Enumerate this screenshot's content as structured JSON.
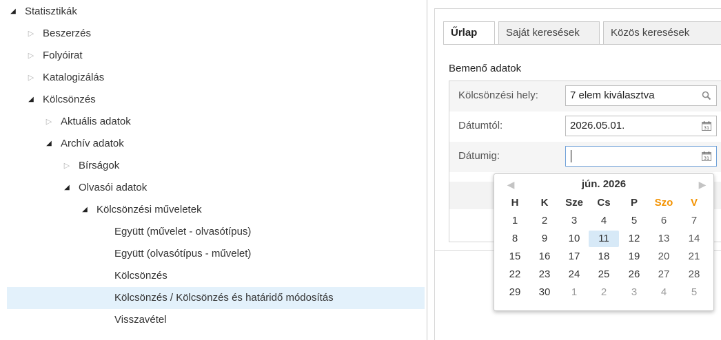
{
  "tree": {
    "items": [
      {
        "label": "Statisztikák",
        "state": "expanded"
      },
      {
        "label": "Beszerzés",
        "state": "collapsed"
      },
      {
        "label": "Folyóirat",
        "state": "collapsed"
      },
      {
        "label": "Katalogizálás",
        "state": "collapsed"
      },
      {
        "label": "Kölcsönzés",
        "state": "expanded"
      },
      {
        "label": "Aktuális adatok",
        "state": "collapsed"
      },
      {
        "label": "Archív adatok",
        "state": "expanded"
      },
      {
        "label": "Bírságok",
        "state": "collapsed"
      },
      {
        "label": "Olvasói adatok",
        "state": "expanded"
      },
      {
        "label": "Kölcsönzési műveletek",
        "state": "expanded"
      },
      {
        "label": "Együtt (művelet - olvasótípus)",
        "state": "leaf"
      },
      {
        "label": "Együtt (olvasótípus - művelet)",
        "state": "leaf"
      },
      {
        "label": "Kölcsönzés",
        "state": "leaf"
      },
      {
        "label": "Kölcsönzés / Kölcsönzés és határidő módosítás",
        "state": "leaf",
        "selected": true
      },
      {
        "label": "Visszavétel",
        "state": "leaf"
      }
    ]
  },
  "form": {
    "tabs": [
      {
        "label": "Űrlap",
        "active": true
      },
      {
        "label": "Saját keresések"
      },
      {
        "label": "Közös keresések"
      }
    ],
    "section_title": "Bemenő adatok",
    "fields": {
      "location": {
        "label": "Kölcsönzési hely:",
        "value": "7 elem kiválasztva",
        "icon": "search-icon"
      },
      "date_from": {
        "label": "Dátumtól:",
        "value": "2026.05.01.",
        "icon": "calendar-icon"
      },
      "date_to": {
        "label": "Dátumig:",
        "value": "",
        "icon": "calendar-icon"
      }
    }
  },
  "datepicker": {
    "title": "jún. 2026",
    "prev_icon": "triangle-left-icon",
    "next_icon": "triangle-right-icon",
    "weekdays": [
      "H",
      "K",
      "Sze",
      "Cs",
      "P",
      "Szo",
      "V"
    ],
    "weekend_color": "#f39200",
    "today_highlight": "#d7e9f7",
    "weeks": [
      [
        "1",
        "2",
        "3",
        "4",
        "5",
        "6",
        "7"
      ],
      [
        "8",
        "9",
        "10",
        "11",
        "12",
        "13",
        "14"
      ],
      [
        "15",
        "16",
        "17",
        "18",
        "19",
        "20",
        "21"
      ],
      [
        "22",
        "23",
        "24",
        "25",
        "26",
        "27",
        "28"
      ],
      [
        "29",
        "30",
        "1",
        "2",
        "3",
        "4",
        "5"
      ]
    ],
    "today": "11"
  }
}
